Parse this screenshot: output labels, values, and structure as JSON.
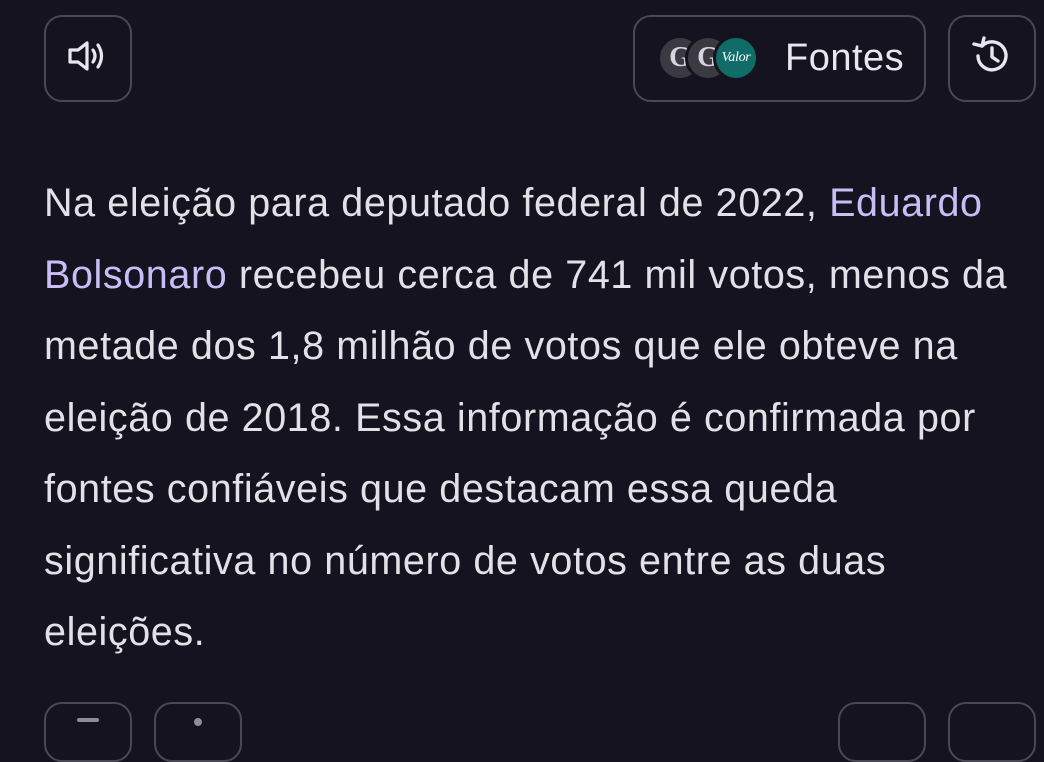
{
  "toolbar": {
    "speaker_icon": "speaker-icon",
    "sources_label": "Fontes",
    "history_icon": "history-icon",
    "sources": [
      {
        "letter": "G"
      },
      {
        "letter": "G"
      },
      {
        "label": "Valor"
      }
    ]
  },
  "answer": {
    "text_before_link": "Na eleição para deputado federal de 2022, ",
    "link_text": "Eduardo Bolsonaro",
    "text_after_link": " recebeu cerca de 741 mil votos, menos da metade dos 1,8 milhão de votos que ele obteve na eleição de 2018. Essa informação é confirmada por fontes confiáveis que destacam essa queda significativa no número de votos entre as duas eleições."
  },
  "colors": {
    "background": "#14131f",
    "text": "#e3e1e8",
    "link": "#c8bdf5",
    "border": "#4a4854",
    "valor_badge": "#0f6c67"
  }
}
